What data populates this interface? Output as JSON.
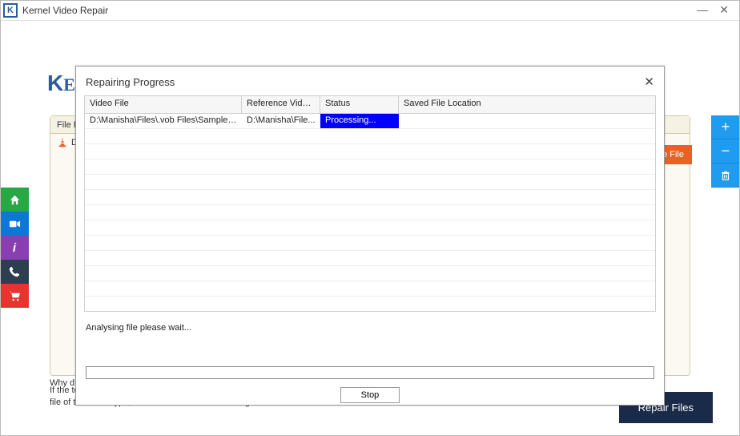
{
  "app": {
    "title": "Kernel Video Repair",
    "logo_prefix": "KE"
  },
  "file_panel": {
    "header_label": "File Pa",
    "row_text": "D:\\",
    "add_reference_label": "ce File"
  },
  "hints": {
    "why": "Why d",
    "notice": "If the tool is not able to identify the basic video structure, you need to add a healthy video file of the same type, same device and same configuration for reference."
  },
  "buttons": {
    "repair": "Repair Files"
  },
  "modal": {
    "title": "Repairing Progress",
    "columns": {
      "video_file": "Video File",
      "reference": "Reference Video...",
      "status": "Status",
      "saved": "Saved File Location"
    },
    "rows": [
      {
        "video_file": "D:\\Manisha\\Files\\.vob Files\\SampleVi...",
        "reference": "D:\\Manisha\\File...",
        "status": "Processing...",
        "saved": ""
      }
    ],
    "analyzing": "Analysing file please wait...",
    "stop": "Stop"
  }
}
